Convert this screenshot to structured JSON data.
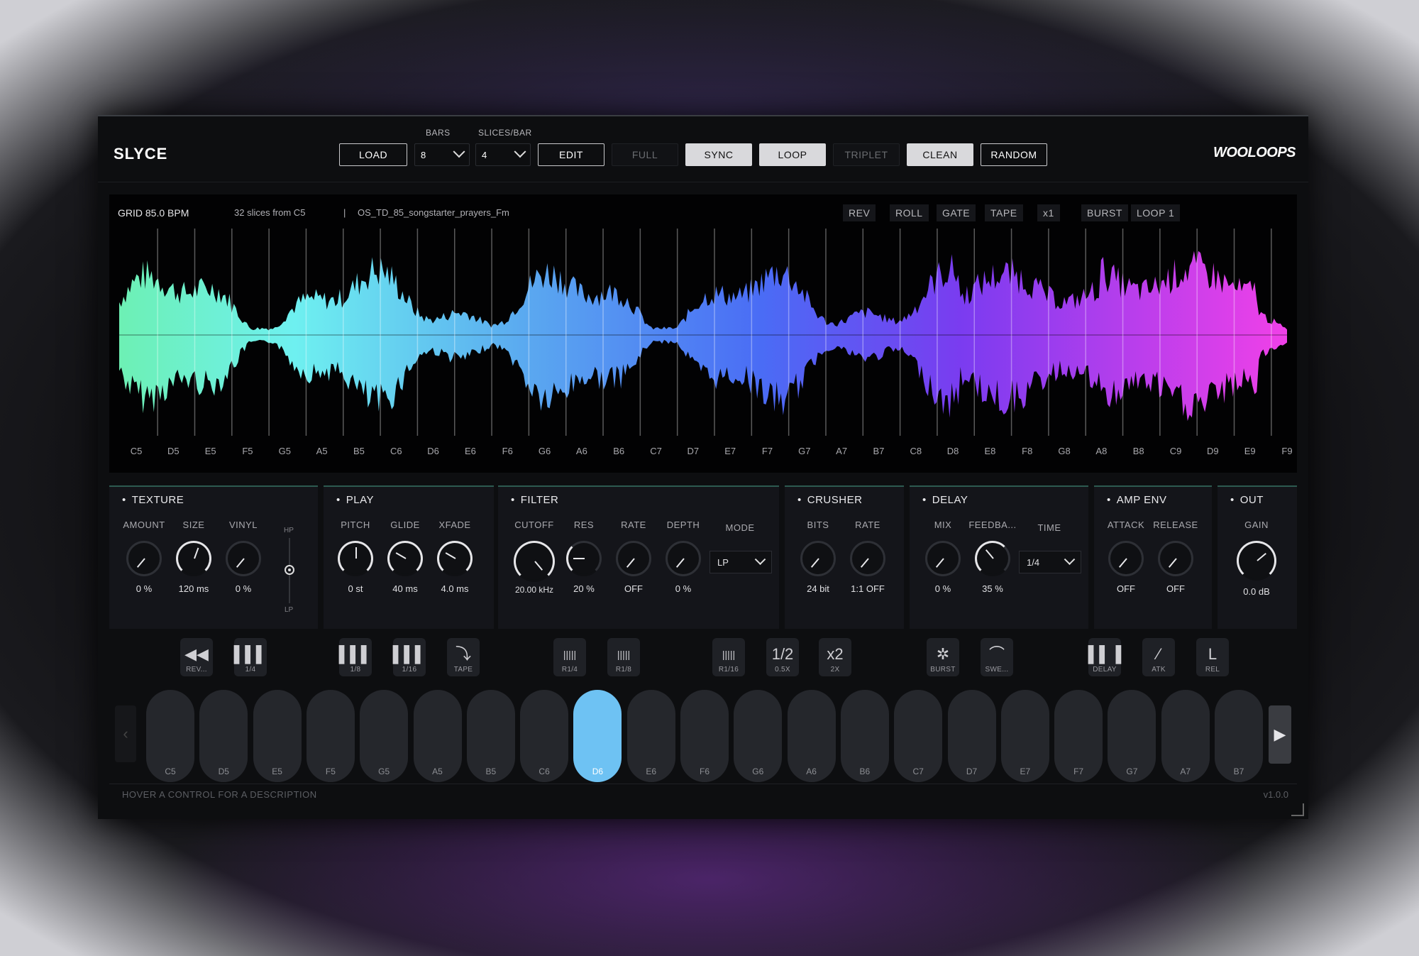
{
  "header": {
    "brand": "SLYCE",
    "brand_right": "WOOLOOPS",
    "load": "LOAD",
    "bars_label": "BARS",
    "bars_value": "8",
    "slices_label": "SLICES/BAR",
    "slices_value": "4",
    "edit": "EDIT",
    "full": "FULL",
    "sync": "SYNC",
    "loop": "LOOP",
    "triplet": "TRIPLET",
    "clean": "CLEAN",
    "random": "RANDOM"
  },
  "wave": {
    "grid": "GRID 85.0 BPM",
    "info": "32 slices from C5",
    "separator": "|",
    "file": "OS_TD_85_songstarter_prayers_Fm",
    "tags": [
      "REV",
      "ROLL",
      "GATE",
      "TAPE",
      "x1",
      "BURST",
      "LOOP 1"
    ],
    "notes": [
      "C5",
      "D5",
      "E5",
      "F5",
      "G5",
      "A5",
      "B5",
      "C6",
      "D6",
      "E6",
      "F6",
      "G6",
      "A6",
      "B6",
      "C7",
      "D7",
      "E7",
      "F7",
      "G7",
      "A7",
      "B7",
      "C8",
      "D8",
      "E8",
      "F8",
      "G8",
      "A8",
      "B8",
      "C9",
      "D9",
      "E9",
      "F9"
    ]
  },
  "texture": {
    "title": "TEXTURE",
    "amount": {
      "label": "AMOUNT",
      "value": "0 %"
    },
    "size": {
      "label": "SIZE",
      "value": "120 ms"
    },
    "vinyl": {
      "label": "VINYL",
      "value": "0 %"
    },
    "hp": "HP",
    "lp": "LP"
  },
  "play": {
    "title": "PLAY",
    "pitch": {
      "label": "PITCH",
      "value": "0 st"
    },
    "glide": {
      "label": "GLIDE",
      "value": "40 ms"
    },
    "xfade": {
      "label": "XFADE",
      "value": "4.0 ms"
    }
  },
  "filter": {
    "title": "FILTER",
    "cutoff": {
      "label": "CUTOFF",
      "value": "20.00 kHz"
    },
    "res": {
      "label": "RES",
      "value": "20 %"
    },
    "rate": {
      "label": "RATE",
      "value": "OFF"
    },
    "depth": {
      "label": "DEPTH",
      "value": "0 %"
    },
    "mode_label": "MODE",
    "mode_value": "LP"
  },
  "crusher": {
    "title": "CRUSHER",
    "bits": {
      "label": "BITS",
      "value": "24 bit"
    },
    "rate": {
      "label": "RATE",
      "value": "1:1 OFF"
    }
  },
  "delay": {
    "title": "DELAY",
    "mix": {
      "label": "MIX",
      "value": "0 %"
    },
    "feedback": {
      "label": "FEEDBA...",
      "value": "35 %"
    },
    "time_label": "TIME",
    "time_value": "1/4"
  },
  "ampenv": {
    "title": "AMP ENV",
    "attack": {
      "label": "ATTACK",
      "value": "OFF"
    },
    "release": {
      "label": "RELEASE",
      "value": "OFF"
    }
  },
  "out": {
    "title": "OUT",
    "gain": {
      "label": "GAIN",
      "value": "0.0 dB"
    }
  },
  "fx": [
    {
      "label": "REV...",
      "icon": "rewind-icon",
      "glyph": "◀◀"
    },
    {
      "label": "1/4",
      "icon": "bars3-icon",
      "glyph": "▌▌▌"
    },
    {
      "label": "1/8",
      "icon": "bars3-icon",
      "glyph": "▌▌▌"
    },
    {
      "label": "1/16",
      "icon": "bars3-icon",
      "glyph": "▌▌▌"
    },
    {
      "label": "TAPE",
      "icon": "tape-curve-icon",
      "glyph": "⤵"
    },
    {
      "label": "R1/4",
      "icon": "roll-icon",
      "glyph": "|||||"
    },
    {
      "label": "R1/8",
      "icon": "roll-icon",
      "glyph": "|||||"
    },
    {
      "label": "R1/16",
      "icon": "roll-icon",
      "glyph": "|||||"
    },
    {
      "label": "0.5X",
      "icon": "half-speed-icon",
      "glyph": "1/2"
    },
    {
      "label": "2X",
      "icon": "double-speed-icon",
      "glyph": "x2"
    },
    {
      "label": "BURST",
      "icon": "burst-icon",
      "glyph": "✲"
    },
    {
      "label": "SWE...",
      "icon": "sweep-icon",
      "glyph": "⌒"
    },
    {
      "label": "DELAY",
      "icon": "delay-icon",
      "glyph": "▌▌▐"
    },
    {
      "label": "ATK",
      "icon": "attack-icon",
      "glyph": "⁄"
    },
    {
      "label": "REL",
      "icon": "release-icon",
      "glyph": "L"
    }
  ],
  "pads": [
    "C5",
    "D5",
    "E5",
    "F5",
    "G5",
    "A5",
    "B5",
    "C6",
    "D6",
    "E6",
    "F6",
    "G6",
    "A6",
    "B6",
    "C7",
    "D7",
    "E7",
    "F7",
    "G7",
    "A7",
    "B7"
  ],
  "active_pad": "D6",
  "status": "HOVER A CONTROL FOR A DESCRIPTION",
  "version": "v1.0.0",
  "colors": {
    "accent": "#6ec2f3",
    "wave_start": "#6df0b4",
    "wave_mid": "#4a6cf5",
    "wave_end": "#f040e8"
  }
}
